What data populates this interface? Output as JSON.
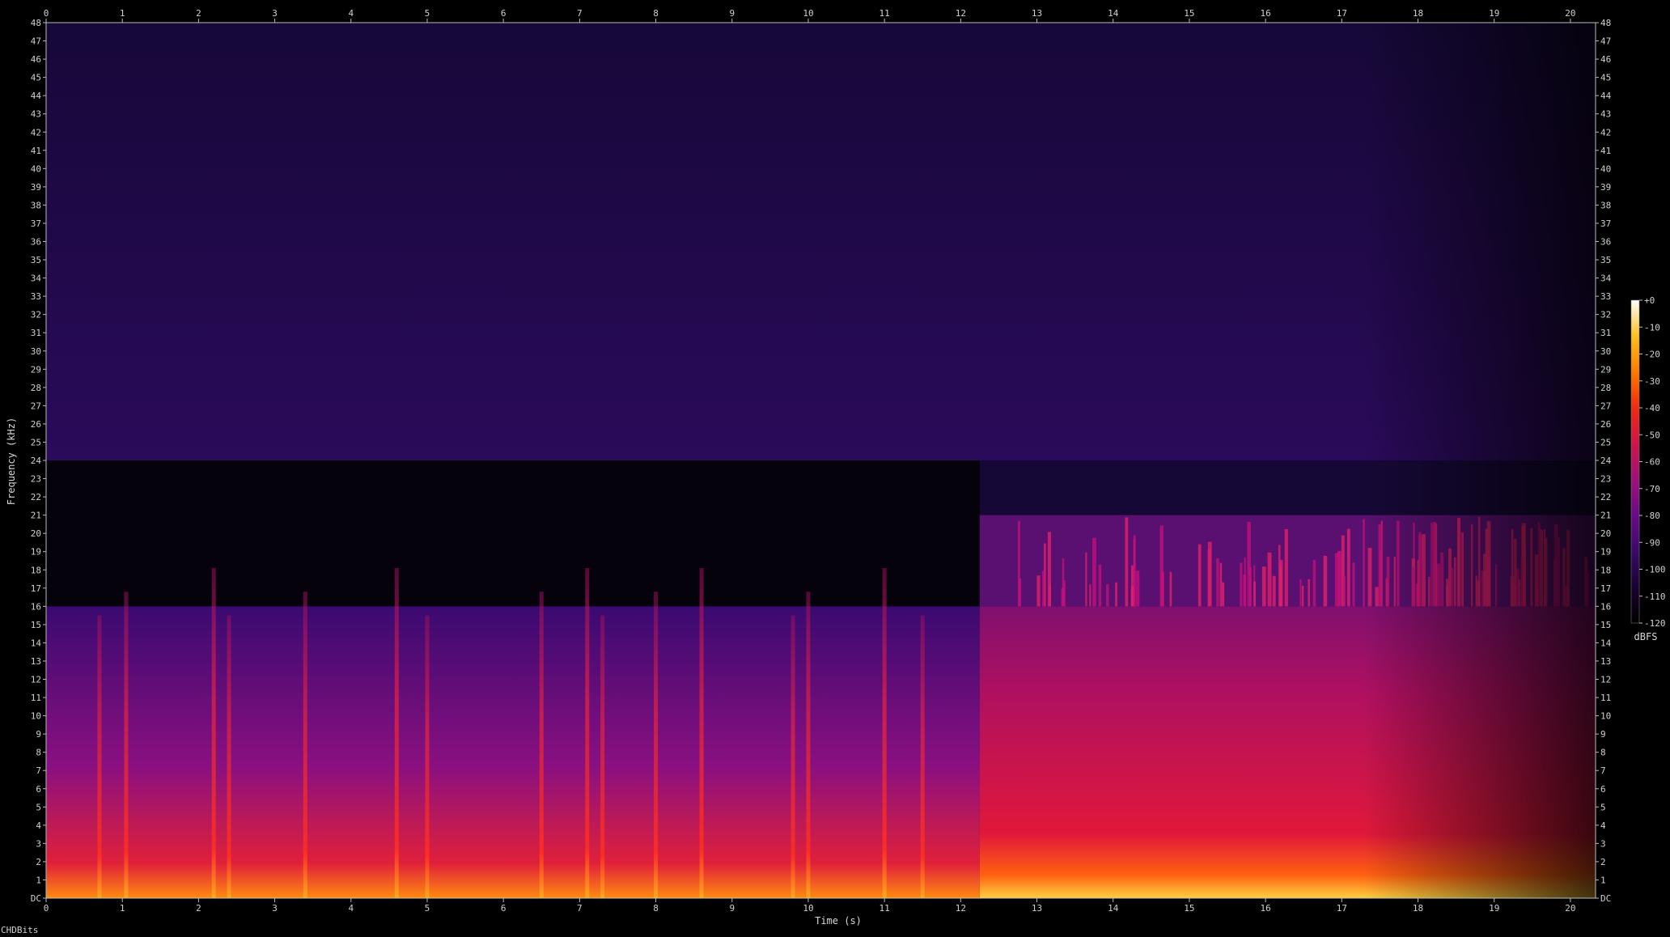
{
  "chart_data": {
    "type": "heatmap",
    "xlabel": "Time (s)",
    "ylabel": "Frequency (kHz)",
    "x_ticks": [
      0,
      1,
      2,
      3,
      4,
      5,
      6,
      7,
      8,
      9,
      10,
      11,
      12,
      13,
      14,
      15,
      16,
      17,
      18,
      19,
      20
    ],
    "y_ticks": [
      "DC",
      1,
      2,
      3,
      4,
      5,
      6,
      7,
      8,
      9,
      10,
      11,
      12,
      13,
      14,
      15,
      16,
      17,
      18,
      19,
      20,
      21,
      22,
      23,
      24,
      25,
      26,
      27,
      28,
      29,
      30,
      31,
      32,
      33,
      34,
      35,
      36,
      37,
      38,
      39,
      40,
      41,
      42,
      43,
      44,
      45,
      46,
      47,
      48
    ],
    "xlim": [
      0,
      20.33
    ],
    "ylim": [
      0,
      48
    ],
    "colorbar": {
      "label": "dBFS",
      "ticks": [
        "+0",
        "-10",
        "-20",
        "-30",
        "-40",
        "-50",
        "-60",
        "-70",
        "-80",
        "-90",
        "-100",
        "-110",
        "-120"
      ],
      "range": [
        -120,
        0
      ],
      "colors": [
        "#000000",
        "#1a0030",
        "#3a0a6a",
        "#6a0a8a",
        "#a0107a",
        "#d0154a",
        "#f02a10",
        "#ff7a00",
        "#ffc020",
        "#ffffff"
      ]
    },
    "regions": [
      {
        "t": [
          0,
          12.25
        ],
        "f": [
          0,
          16
        ],
        "level_dB": -75
      },
      {
        "t": [
          0,
          12.25
        ],
        "f": [
          16,
          24
        ],
        "level_dB": -118
      },
      {
        "t": [
          12.25,
          20.33
        ],
        "f": [
          0,
          16
        ],
        "level_dB": -55
      },
      {
        "t": [
          12.25,
          20.33
        ],
        "f": [
          16,
          21
        ],
        "level_dB": -80
      },
      {
        "t": [
          0,
          20.33
        ],
        "f": [
          24,
          48
        ],
        "level_dB": -100
      }
    ],
    "transients_s": [
      0.7,
      1.05,
      2.2,
      2.4,
      3.4,
      4.6,
      5.0,
      6.5,
      7.1,
      7.3,
      8.0,
      8.6,
      9.8,
      10.0,
      11.0,
      11.5
    ]
  },
  "footer": {
    "text": "CHDBits"
  }
}
